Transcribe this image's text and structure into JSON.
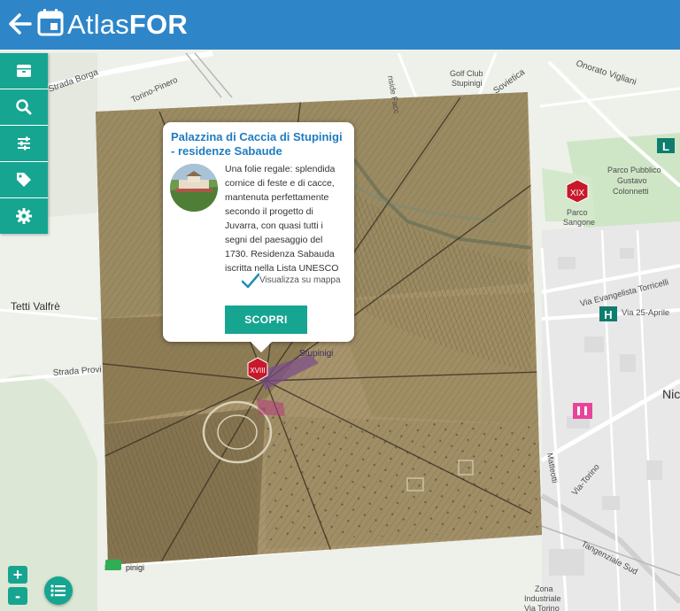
{
  "app": {
    "title_prefix": "Atlas",
    "title_suffix": "FOR"
  },
  "toolbar": {
    "items": [
      {
        "icon": "archive-box-icon"
      },
      {
        "icon": "search-icon"
      },
      {
        "icon": "sliders-icon"
      },
      {
        "icon": "tag-icon"
      },
      {
        "icon": "gear-icon"
      }
    ]
  },
  "popup": {
    "title": "Palazzina di Caccia di Stupinigi - residenze Sabaude",
    "description": "Una folie regale: splendida cornice di feste e di cacce, mantenuta perfettamente secondo il progetto di Juvarra, con quasi tutti i segni del paesaggio del 1730. Residenza Sabauda iscritta nella Lista UNESCO",
    "show_on_map": "Visualizza su mappa",
    "button": "SCOPRI"
  },
  "map": {
    "labels": {
      "golf": "Golf Club",
      "golf2": "Stupinigi",
      "park1": "Parco Pubblico",
      "park2": "Gustavo",
      "park3": "Colonnetti",
      "sangone1": "Parco",
      "sangone2": "Sangone",
      "tetti": "Tetti Valfrè",
      "strada_prov": "Strada Provi",
      "via_ev": "Via Evangelista Torricelli",
      "via_25": "Via 25-Aprile",
      "via_tor": "Via Torino",
      "tangenziale": "Tangenziale Sud",
      "zona1": "Zona",
      "zona2": "Industriale",
      "zona3": "Via Torino",
      "strada_borgaretto": "Strada Borga",
      "corso_sov": "Sovietica",
      "corso_onor": "Onorato Vigliani",
      "nic": "Nic",
      "stupinigi_old": "Stupinigi",
      "pcs": "Po",
      "upinigi": "pinigi",
      "torino_pin": "Torino-Pinero",
      "nalisti": "nalisti",
      "nside": "nside Facc",
      "matteotti": "Matteotti",
      "via_tor2": "Via-Torino"
    },
    "markers": {
      "century_19": "XIX",
      "century_18": "XVIII",
      "l_badge": "L",
      "h_badge": "H"
    }
  },
  "controls": {
    "zoom_in": "+",
    "zoom_out": "-"
  },
  "colors": {
    "header": "#2e86c8",
    "accent": "#16a591",
    "marker_red": "#c8182a",
    "badge_teal": "#0f7d6e"
  }
}
